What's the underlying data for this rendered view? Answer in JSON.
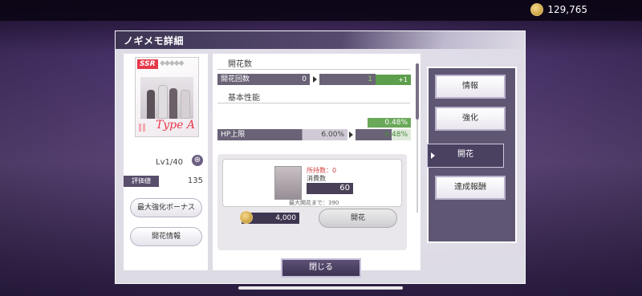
{
  "header": {
    "coin_amount": "129,765"
  },
  "dialog": {
    "title": "ノギメモ詳細",
    "card": {
      "rarity": "SSR",
      "stars": "◆◆◆◆◆",
      "logo": "Type A",
      "level": "Lv1/40"
    },
    "evaluation": {
      "label": "評価値",
      "value": "135"
    },
    "left_buttons": {
      "max_boost": "最大強化ボーナス",
      "bloom_info": "開花情報"
    },
    "sections": {
      "bloom_count": {
        "heading": "開花数",
        "label": "開花回数",
        "current": "0",
        "next": "1",
        "delta": "+1"
      },
      "basic": {
        "heading": "基本性能",
        "delta": "0.48%",
        "hp_label": "HP上限",
        "hp_current": "6.00%",
        "hp_next": "6.48%"
      }
    },
    "popup": {
      "owned": "所持数：0",
      "cost_label": "消費数",
      "cost_value": "60",
      "max_note": "最大開花まで：390",
      "coin_cost": "4,000",
      "bloom_button": "開花"
    },
    "tabs": {
      "info": "情報",
      "enhance": "強化",
      "bloom": "開花",
      "reward": "達成報酬"
    },
    "close_button": "閉じる"
  },
  "colors": {
    "accent": "#4a4060",
    "green": "#5c9e4c",
    "ssr": "#e6394a"
  }
}
